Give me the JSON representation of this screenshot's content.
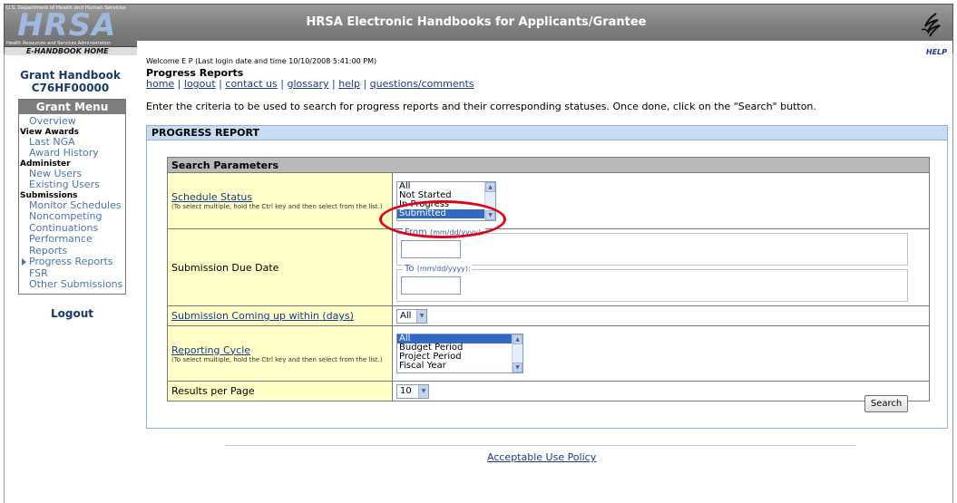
{
  "header": {
    "hhs_text": "U.S. Department of Health and Human Services",
    "logo_text": "HRSA",
    "logo_sub": "Health Resources and Services Administration",
    "home_link": "E-HANDBOOK HOME",
    "title": "HRSA Electronic Handbooks for Applicants/Grantee",
    "help": "HELP"
  },
  "welcome": {
    "text": "Welcome E     P      (Last login date and time 10/10/2008 5:41:00 PM)"
  },
  "page_title": "Progress Reports",
  "nav": {
    "home": "home",
    "logout": "logout",
    "contact": "contact us",
    "glossary": "glossary",
    "help": "help",
    "questions": "questions/comments",
    "sep": " | "
  },
  "instructions": "Enter the criteria to be used to search for progress reports and their corresponding statuses. Once done, click on the \"Search\" button.",
  "sidebar": {
    "handbook_title": "Grant Handbook",
    "handbook_id": "C76HF00000",
    "menu_title": "Grant Menu",
    "items": [
      {
        "type": "link",
        "label": "Overview"
      },
      {
        "type": "group",
        "label": "View Awards"
      },
      {
        "type": "link",
        "label": "Last NGA"
      },
      {
        "type": "link",
        "label": "Award History"
      },
      {
        "type": "group",
        "label": "Administer"
      },
      {
        "type": "link",
        "label": "New Users"
      },
      {
        "type": "link",
        "label": "Existing Users"
      },
      {
        "type": "group",
        "label": "Submissions"
      },
      {
        "type": "link",
        "label": "Monitor Schedules"
      },
      {
        "type": "link",
        "label": "Noncompeting"
      },
      {
        "type": "link",
        "label": "Continuations"
      },
      {
        "type": "link",
        "label": "Performance"
      },
      {
        "type": "link",
        "label": "Reports"
      },
      {
        "type": "active",
        "label": "Progress Reports"
      },
      {
        "type": "link",
        "label": "FSR"
      },
      {
        "type": "link",
        "label": "Other Submissions"
      }
    ],
    "logout": "Logout"
  },
  "panel": {
    "title": "PROGRESS REPORT",
    "search_params": "Search Parameters",
    "schedule_status": {
      "label": "Schedule Status",
      "hint": "(To select multiple, hold the Ctrl key and then select from the list.)",
      "options": [
        "All",
        "Not Started",
        "In Progress",
        "Submitted"
      ],
      "selected": "Submitted"
    },
    "due_date": {
      "label": "Submission Due Date",
      "from_label": "From",
      "to_label": "To",
      "format": "(mm/dd/yyyy):"
    },
    "coming_up": {
      "label": "Submission Coming up within (days)",
      "value": "All"
    },
    "reporting_cycle": {
      "label": "Reporting Cycle",
      "hint": "(To select multiple, hold the Ctrl key and then select from the list.)",
      "options": [
        "All",
        "Budget Period",
        "Project Period",
        "Fiscal Year"
      ],
      "selected": "All"
    },
    "results_per_page": {
      "label": "Results per Page",
      "value": "10"
    },
    "search_button": "Search"
  },
  "footer": {
    "link": "Acceptable Use Policy"
  },
  "colors": {
    "header_gray": "#7d7d7d",
    "link_blue": "#1a3a8a",
    "menu_link": "#4a74b0",
    "label_bg": "#ffffc8",
    "panel_head": "#c6ddf4",
    "highlight_oval": "#e0001a",
    "selection": "#316ac5"
  }
}
